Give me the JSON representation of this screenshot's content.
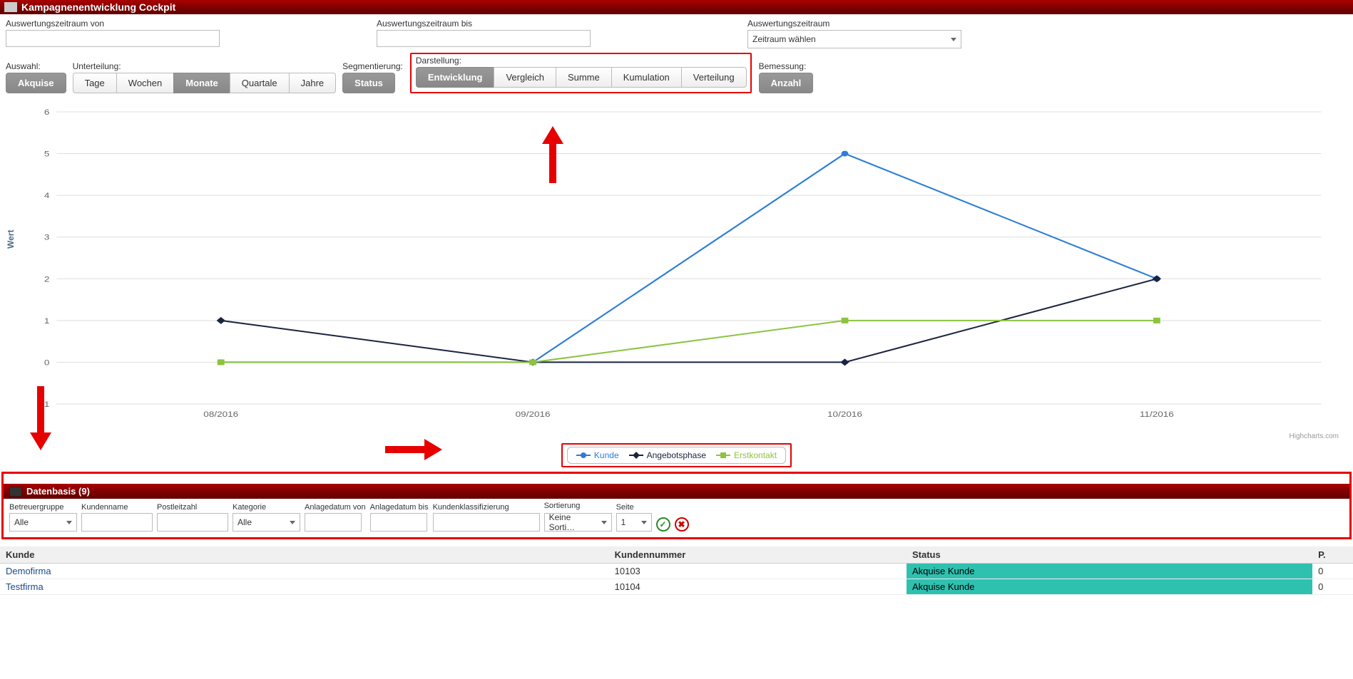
{
  "header": {
    "title": "Kampagnenentwicklung Cockpit"
  },
  "filters": {
    "von_label": "Auswertungszeitraum von",
    "bis_label": "Auswertungszeitraum bis",
    "zeitraum_label": "Auswertungszeitraum",
    "zeitraum_value": "Zeitraum wählen"
  },
  "toolbar": {
    "auswahl_label": "Auswahl:",
    "auswahl_button": "Akquise",
    "unterteilung_label": "Unterteilung:",
    "unterteilung": [
      "Tage",
      "Wochen",
      "Monate",
      "Quartale",
      "Jahre"
    ],
    "segmentierung_label": "Segmentierung:",
    "segmentierung_button": "Status",
    "darstellung_label": "Darstellung:",
    "darstellung": [
      "Entwicklung",
      "Vergleich",
      "Summe",
      "Kumulation",
      "Verteilung"
    ],
    "bemessung_label": "Bemessung:",
    "bemessung_button": "Anzahl"
  },
  "chart_data": {
    "type": "line",
    "ylabel": "Wert",
    "xlabel": "",
    "categories": [
      "08/2016",
      "09/2016",
      "10/2016",
      "11/2016"
    ],
    "ylim": [
      -1,
      6
    ],
    "yticks": [
      -1,
      0,
      1,
      2,
      3,
      4,
      5,
      6
    ],
    "series": [
      {
        "name": "Kunde",
        "color": "#2e7cd6",
        "marker": "circle",
        "values": [
          0,
          0,
          5,
          2
        ]
      },
      {
        "name": "Angebotsphase",
        "color": "#1a2340",
        "marker": "diamond",
        "values": [
          1,
          0,
          0,
          2
        ]
      },
      {
        "name": "Erstkontakt",
        "color": "#8bc43f",
        "marker": "square",
        "values": [
          0,
          0,
          1,
          1
        ]
      }
    ],
    "credits": "Highcharts.com"
  },
  "datenbasis": {
    "title_prefix": "Datenbasis",
    "count": 9,
    "labels": {
      "betreuergruppe": "Betreuergruppe",
      "kundenname": "Kundenname",
      "postleitzahl": "Postleitzahl",
      "kategorie": "Kategorie",
      "anlagedatum_von": "Anlagedatum von",
      "anlagedatum_bis": "Anlagedatum bis",
      "kundenklassifizierung": "Kundenklassifizierung",
      "sortierung": "Sortierung",
      "seite": "Seite"
    },
    "values": {
      "betreuergruppe": "Alle",
      "kategorie": "Alle",
      "sortierung": "Keine Sorti…",
      "seite": "1"
    }
  },
  "table": {
    "headers": {
      "kunde": "Kunde",
      "kundennummer": "Kundennummer",
      "status": "Status",
      "p": "P."
    },
    "rows": [
      {
        "kunde": "Demofirma",
        "kundennummer": "10103",
        "status": "Akquise Kunde",
        "p": "0"
      },
      {
        "kunde": "Testfirma",
        "kundennummer": "10104",
        "status": "Akquise Kunde",
        "p": "0"
      }
    ]
  }
}
